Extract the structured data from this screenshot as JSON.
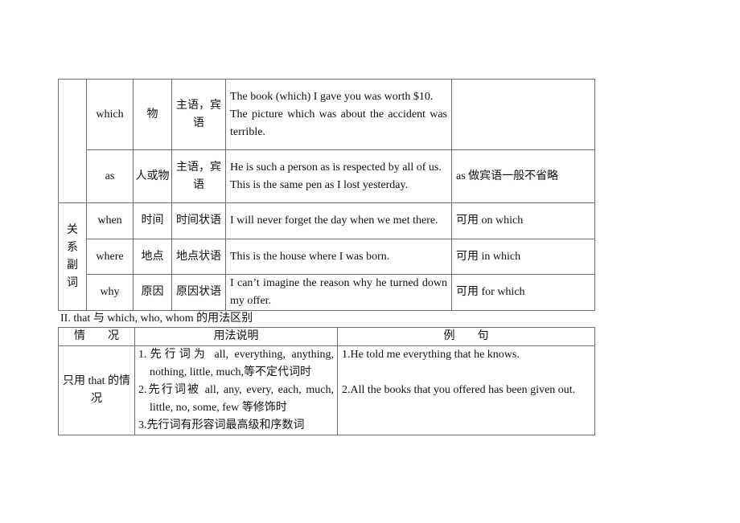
{
  "table1": {
    "group_relative_pronoun": "",
    "group_relative_adverb": [
      "关",
      "系",
      "副",
      "词"
    ],
    "rows": [
      {
        "word": "which",
        "antecedent": "物",
        "function": "主语，宾语",
        "examples": [
          "The book (which) I gave you was worth $10.",
          "The picture which was about the accident was terrible."
        ],
        "note": ""
      },
      {
        "word": "as",
        "antecedent": "人或物",
        "function": "主语，宾语",
        "examples": [
          "He is such a person as is respected by all of us.",
          "This is the same pen as I lost yesterday."
        ],
        "note": "as 做宾语一般不省略"
      },
      {
        "word": "when",
        "antecedent": "时间",
        "function": "时间状语",
        "examples": [
          "I will never forget the day when we met there."
        ],
        "note": "可用 on which"
      },
      {
        "word": "where",
        "antecedent": "地点",
        "function": "地点状语",
        "examples": [
          "This is the house where I was born."
        ],
        "note": "可用 in which"
      },
      {
        "word": "why",
        "antecedent": "原因",
        "function": "原因状语",
        "examples": [
          "I can’t imagine the reason why he turned down my offer."
        ],
        "note": "可用 for which"
      }
    ]
  },
  "section_heading": "II. that 与 which, who, whom 的用法区别",
  "table2": {
    "headers": [
      "情　　况",
      "用法说明",
      "例　　句"
    ],
    "rows": [
      {
        "situation": "只用 that 的情况",
        "usage": [
          "1.先行词为 all, everything, anything, nothing, little, much,等不定代词时",
          "2.先行词被 all, any, every, each, much, little, no, some, few 等修饰时",
          "3.先行词有形容词最高级和序数词"
        ],
        "examples": [
          "1.He told me everything that he knows.",
          "2.All the books that you offered has been given out."
        ]
      }
    ]
  }
}
